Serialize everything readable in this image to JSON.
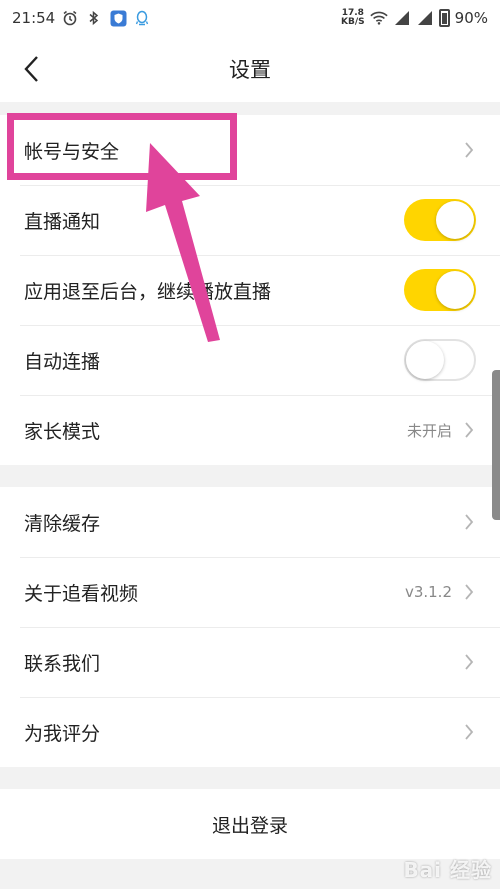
{
  "status_bar": {
    "time": "21:54",
    "net_speed_value": "17.8",
    "net_speed_unit": "KB/S",
    "battery": "90%"
  },
  "nav": {
    "title": "设置"
  },
  "group1": [
    {
      "label": "帐号与安全",
      "type": "link"
    },
    {
      "label": "直播通知",
      "type": "toggle",
      "on": true
    },
    {
      "label": "应用退至后台，继续播放直播",
      "type": "toggle",
      "on": true
    },
    {
      "label": "自动连播",
      "type": "toggle",
      "on": false
    },
    {
      "label": "家长模式",
      "type": "link",
      "value": "未开启"
    }
  ],
  "group2": [
    {
      "label": "清除缓存",
      "type": "link"
    },
    {
      "label": "关于追看视频",
      "type": "link",
      "value": "v3.1.2"
    },
    {
      "label": "联系我们",
      "type": "link"
    },
    {
      "label": "为我评分",
      "type": "link"
    }
  ],
  "logout": {
    "label": "退出登录"
  },
  "watermark": "Bai 经验",
  "colors": {
    "toggle_on": "#ffd500",
    "annotation": "#e0449b"
  }
}
